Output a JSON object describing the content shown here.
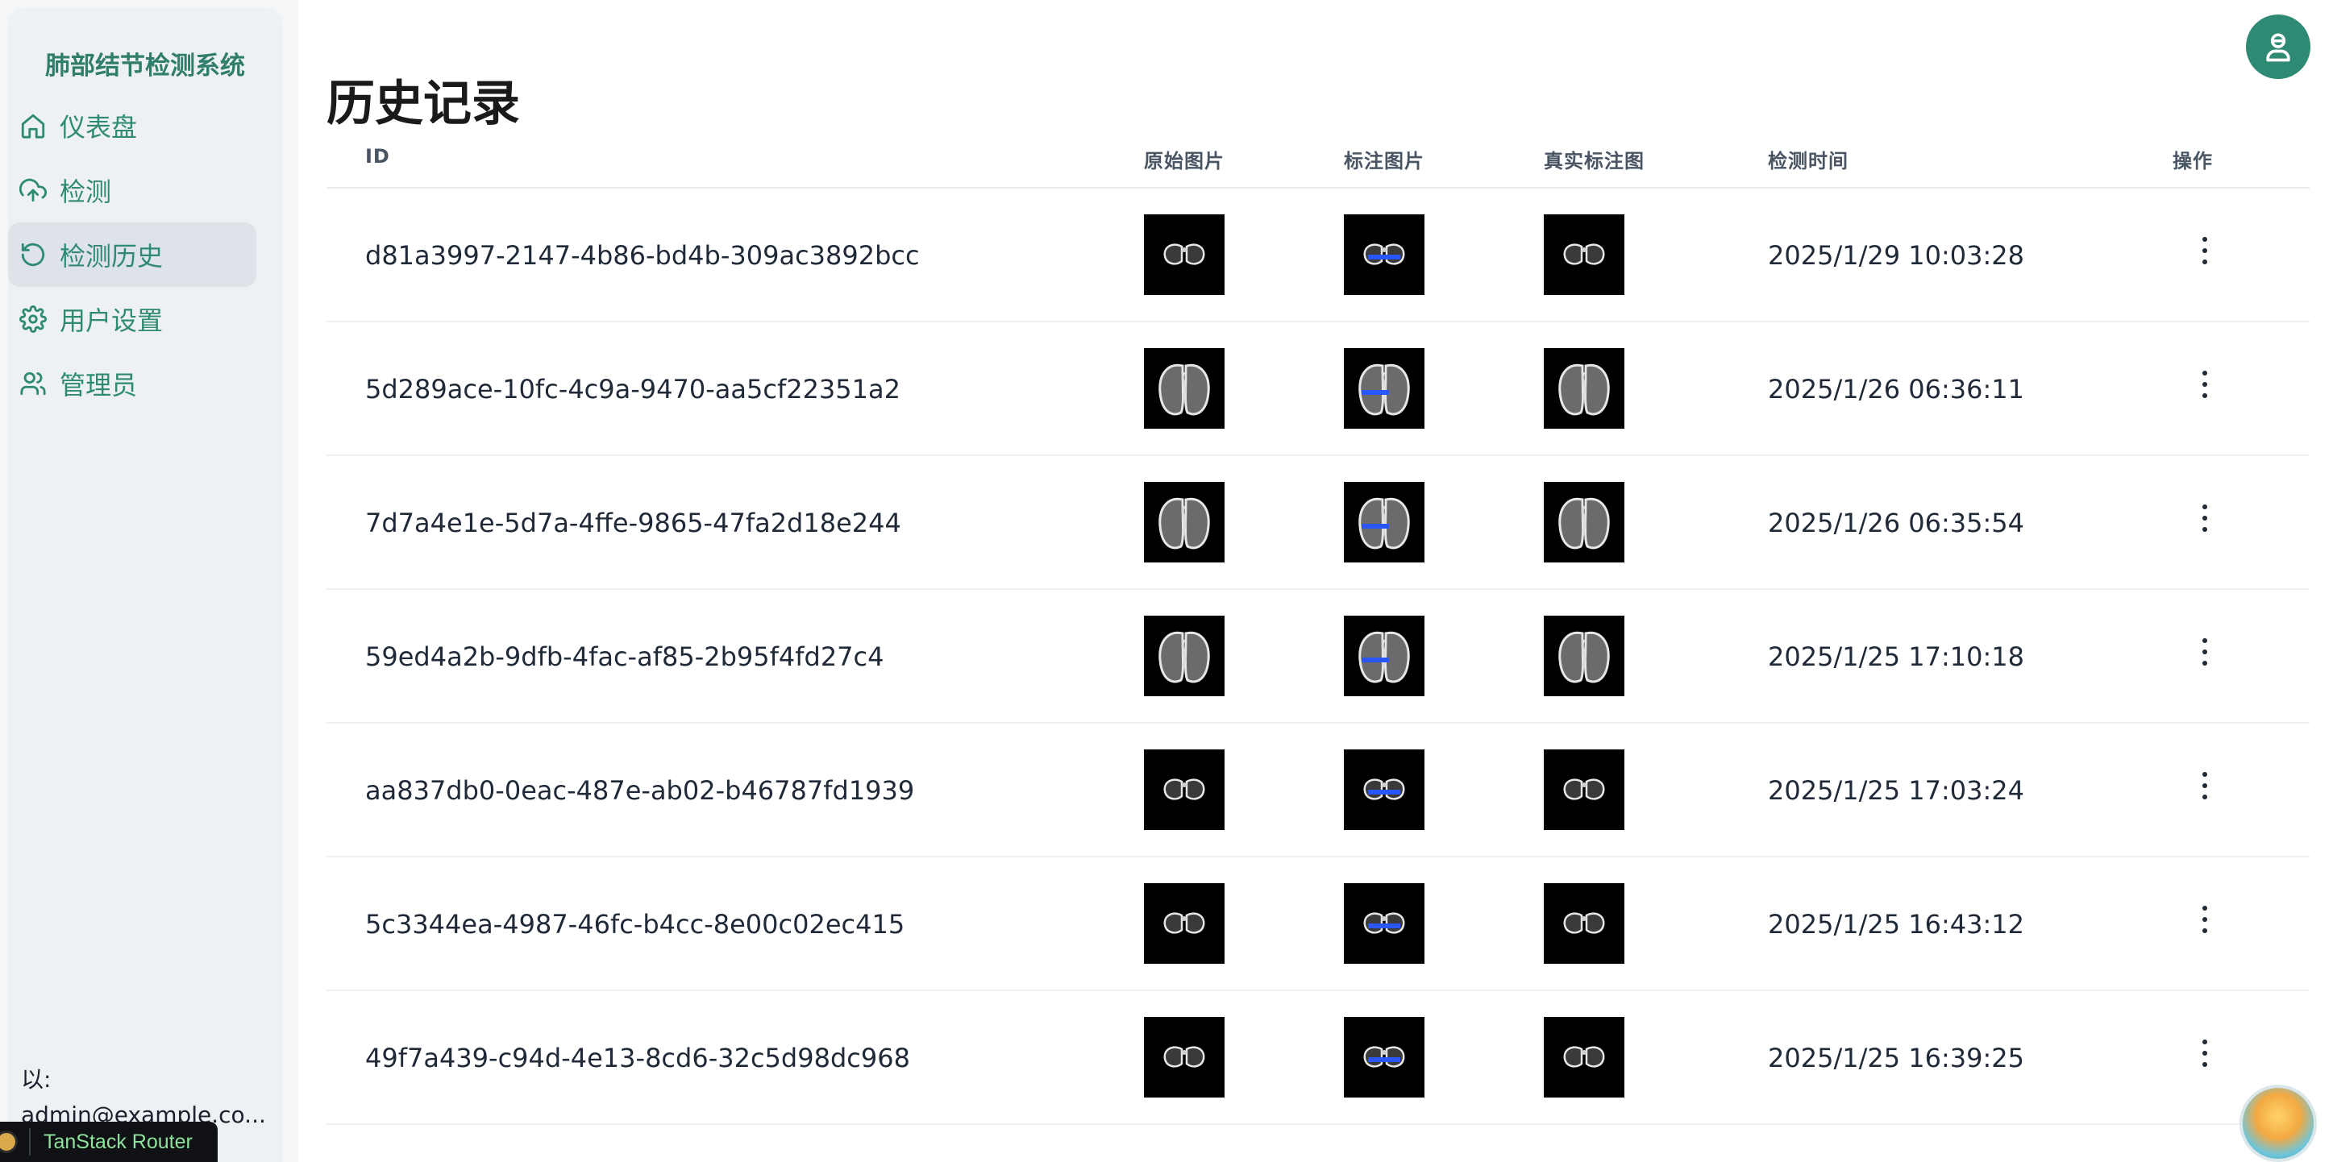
{
  "app": {
    "title": "肺部结节检测系统",
    "accent_color": "#2f8a73"
  },
  "sidebar": {
    "items": [
      {
        "label": "仪表盘",
        "icon": "home-icon",
        "active": false
      },
      {
        "label": "检测",
        "icon": "upload-cloud-icon",
        "active": false
      },
      {
        "label": "检测历史",
        "icon": "history-icon",
        "active": true
      },
      {
        "label": "用户设置",
        "icon": "gear-icon",
        "active": false
      },
      {
        "label": "管理员",
        "icon": "users-icon",
        "active": false
      }
    ],
    "signed_in_prefix": "以:",
    "signed_in_user": "admin@example.co..."
  },
  "devtools": {
    "label": "TanStack Router"
  },
  "page": {
    "title": "历史记录"
  },
  "table": {
    "headers": {
      "id": "ID",
      "original": "原始图片",
      "annotated": "标注图片",
      "ground_truth": "真实标注图",
      "time": "检测时间",
      "actions": "操作"
    },
    "rows": [
      {
        "id": "d81a3997-2147-4b86-bd4b-309ac3892bcc",
        "time": "2025/1/29 10:03:28",
        "scan": "small"
      },
      {
        "id": "5d289ace-10fc-4c9a-9470-aa5cf22351a2",
        "time": "2025/1/26 06:36:11",
        "scan": "large"
      },
      {
        "id": "7d7a4e1e-5d7a-4ffe-9865-47fa2d18e244",
        "time": "2025/1/26 06:35:54",
        "scan": "large"
      },
      {
        "id": "59ed4a2b-9dfb-4fac-af85-2b95f4fd27c4",
        "time": "2025/1/25 17:10:18",
        "scan": "large"
      },
      {
        "id": "aa837db0-0eac-487e-ab02-b46787fd1939",
        "time": "2025/1/25 17:03:24",
        "scan": "small"
      },
      {
        "id": "5c3344ea-4987-46fc-b4cc-8e00c02ec415",
        "time": "2025/1/25 16:43:12",
        "scan": "small"
      },
      {
        "id": "49f7a439-c94d-4e13-8cd6-32c5d98dc968",
        "time": "2025/1/25 16:39:25",
        "scan": "small"
      }
    ]
  }
}
